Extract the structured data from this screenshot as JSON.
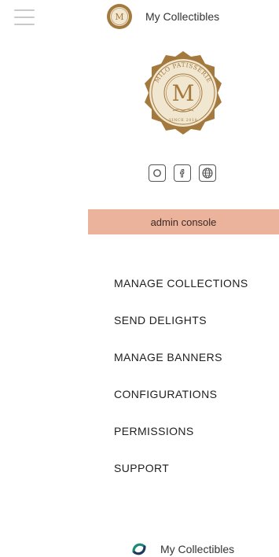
{
  "header": {
    "title": "My Collectibles",
    "menu_icon": "hamburger-menu-icon",
    "logo": "brand-seal-logo"
  },
  "seal": {
    "text_top": "MILO PATISSERIE",
    "monogram": "M",
    "text_bottom": "SINCE 2018",
    "colors": {
      "gold": "#a4793e",
      "cream": "#f1e7d0"
    }
  },
  "social": [
    {
      "icon": "instagram-icon"
    },
    {
      "icon": "facebook-icon"
    },
    {
      "icon": "globe-icon"
    }
  ],
  "admin_label": "admin console",
  "menu": [
    "MANAGE COLLECTIONS",
    "SEND DELIGHTS",
    "MANAGE BANNERS",
    "CONFIGURATIONS",
    "PERMISSIONS",
    "SUPPORT"
  ],
  "footer": {
    "title": "My Collectibles",
    "logo": "my-collectibles-logo-icon",
    "colors": {
      "teal": "#1b8b73",
      "navy": "#1e3a5c"
    }
  },
  "colors": {
    "accent_bar": "#ecb39c"
  }
}
